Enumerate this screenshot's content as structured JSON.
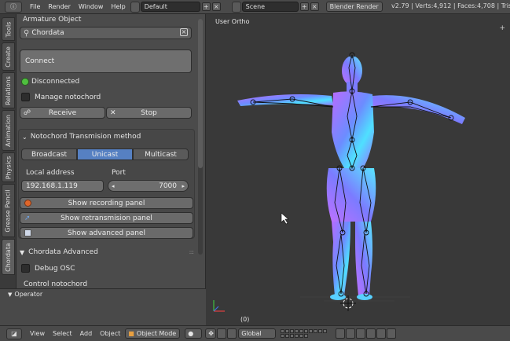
{
  "topbar": {
    "menus": [
      "File",
      "Render",
      "Window",
      "Help"
    ],
    "layout": "Default",
    "scene": "Scene",
    "engine": "Blender Render",
    "stats": "v2.79 | Verts:4,912 | Faces:4,708 | Tris:8,"
  },
  "tabs": [
    "Tools",
    "Create",
    "Relations",
    "Animation",
    "Physics",
    "Grease Pencil",
    "Chordata"
  ],
  "shelf": {
    "armature_label": "Armature Object",
    "armature_value": "Chordata",
    "connect_label": "Connect",
    "status": "Disconnected",
    "status_color": "#4fbf3f",
    "manage_label": "Manage notochord",
    "receive_label": "Receive",
    "stop_label": "Stop",
    "transmission_title": "Notochord Transmision method",
    "methods": [
      "Broadcast",
      "Unicast",
      "Multicast"
    ],
    "active_method": "Unicast",
    "local_address_label": "Local address",
    "local_address_value": "192.168.1.119",
    "port_label": "Port",
    "port_value": "7000",
    "recording_label": "Show recording panel",
    "retrans_label": "Show retransmision panel",
    "advanced_label": "Show advanced panel",
    "advanced_section": "Chordata Advanced",
    "debug_label": "Debug OSC",
    "control_label": "Control notochord"
  },
  "operator": {
    "title": "Operator"
  },
  "viewport": {
    "label": "User Ortho",
    "frame": "(0)"
  },
  "bottombar": {
    "menus": [
      "View",
      "Select",
      "Add",
      "Object"
    ],
    "mode": "Object Mode",
    "orientation": "Global"
  }
}
